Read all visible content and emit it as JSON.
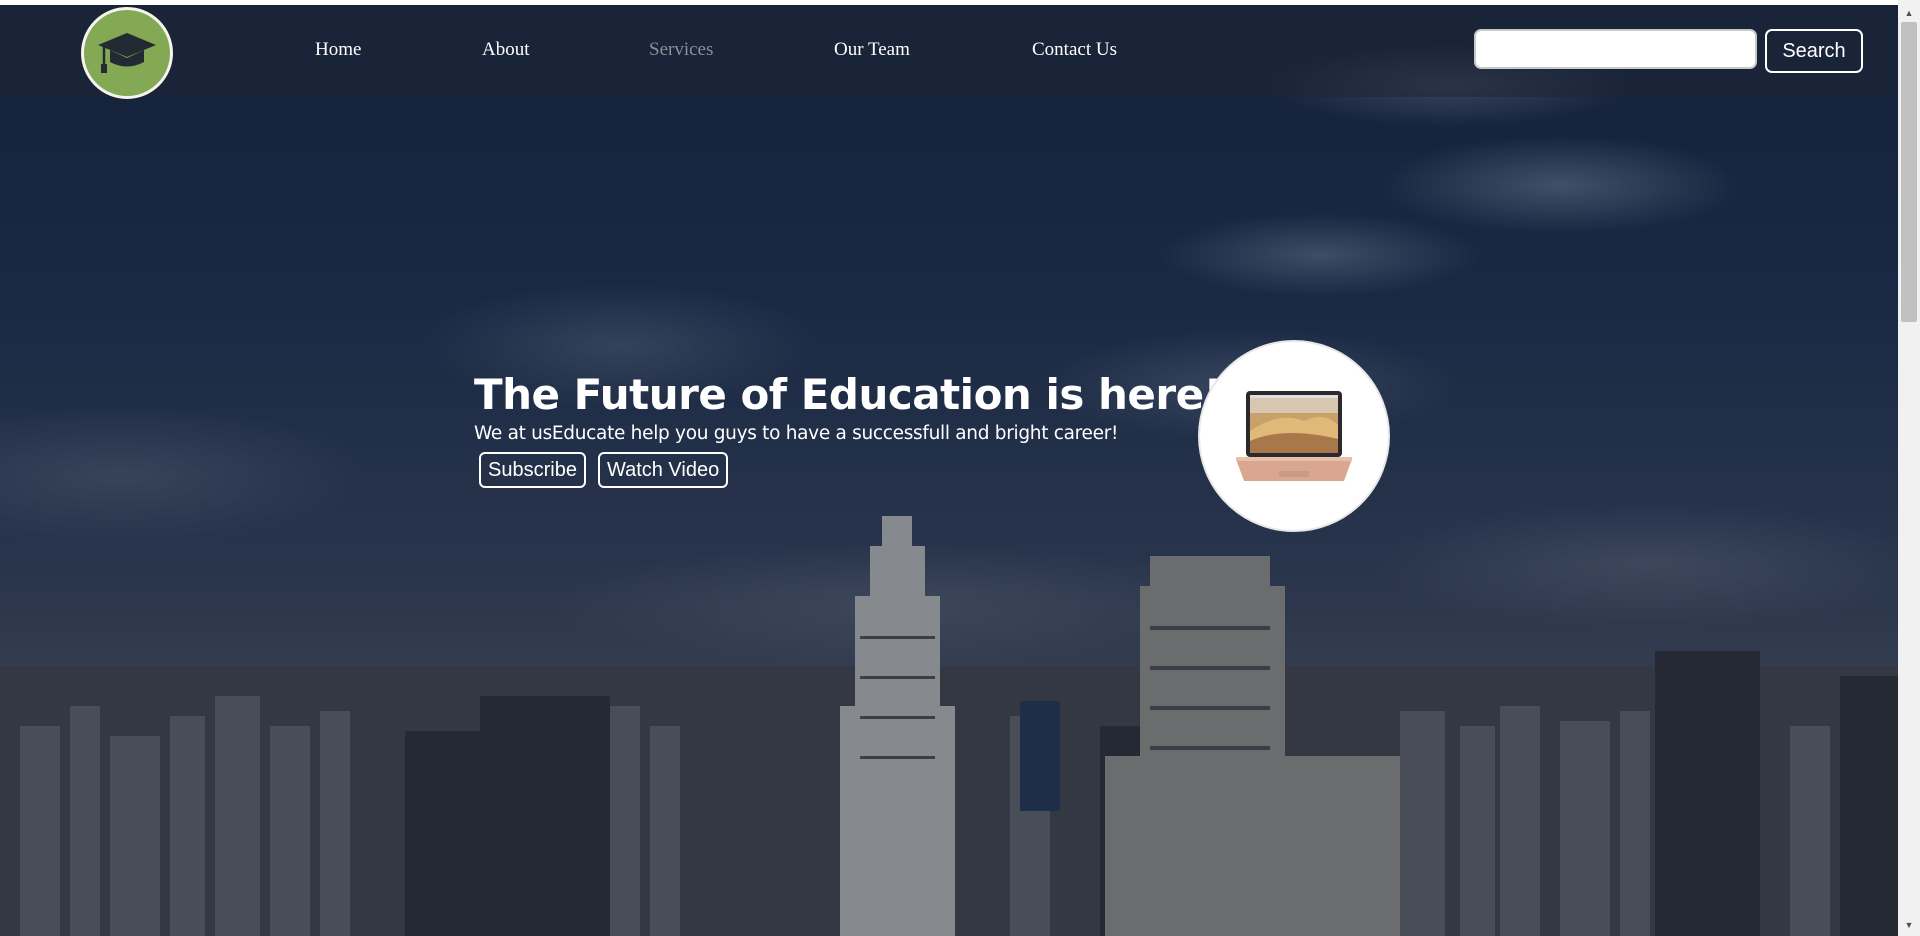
{
  "brand": {
    "logo_icon": "graduation-cap-icon",
    "logo_color": "#84a954"
  },
  "nav": {
    "items": [
      {
        "label": "Home",
        "active": false
      },
      {
        "label": "About",
        "active": false
      },
      {
        "label": "Services",
        "active": true
      },
      {
        "label": "Our Team",
        "active": false
      },
      {
        "label": "Contact Us",
        "active": false
      }
    ]
  },
  "search": {
    "value": "",
    "placeholder": "",
    "button_label": "Search"
  },
  "hero": {
    "title": "The Future of Education is here!",
    "subtitle": "We at usEducate help you guys to have a successfull and bright career!",
    "buttons": [
      "Subscribe",
      "Watch Video"
    ],
    "image_icon": "laptop-icon"
  },
  "colors": {
    "nav_active": "#8c8f98",
    "text": "#ffffff"
  }
}
